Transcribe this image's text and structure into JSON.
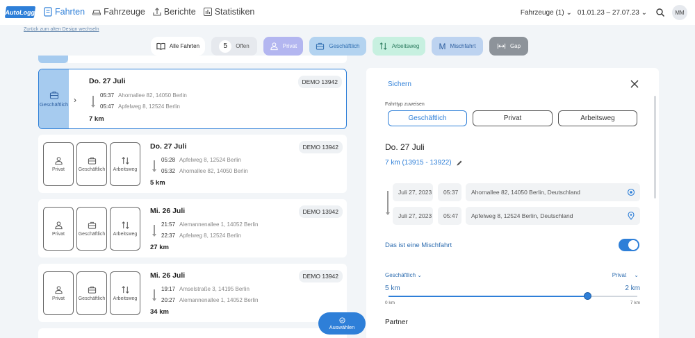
{
  "app": {
    "logo": "AutoLogg"
  },
  "nav": [
    {
      "label": "Fahrten",
      "icon": "document-icon",
      "active": true
    },
    {
      "label": "Fahrzeuge",
      "icon": "car-icon",
      "active": false
    },
    {
      "label": "Berichte",
      "icon": "upload-report-icon",
      "active": false
    },
    {
      "label": "Statistiken",
      "icon": "chart-icon",
      "active": false
    }
  ],
  "topright": {
    "vehicles": "Fahrzeuge (1)",
    "daterange": "01.01.23 – 27.07.23",
    "avatar": "MM"
  },
  "old_design_link": "Zurück zum alten Design wechseln",
  "filters": {
    "all": "Alle Fahrten",
    "open_count": "5",
    "open": "Offen",
    "private": "Privat",
    "business": "Geschäftlich",
    "commute": "Arbeitsweg",
    "mixed": "Mischfahrt",
    "gap": "Gap"
  },
  "categories": {
    "private": "Privat",
    "business": "Geschäftlich",
    "commute": "Arbeitsweg"
  },
  "trips": [
    {
      "date": "Do. 27 Juli",
      "vehicle": "DEMO 13942",
      "start_time": "05:37",
      "start_addr": "Ahornallee 82, 14050 Berlin",
      "end_time": "05:47",
      "end_addr": "Apfelweg 8, 12524 Berlin",
      "distance": "7 km",
      "selected": true
    },
    {
      "date": "Do. 27 Juli",
      "vehicle": "DEMO 13942",
      "start_time": "05:28",
      "start_addr": "Apfelweg 8, 12524 Berlin",
      "end_time": "05:32",
      "end_addr": "Ahornallee 82, 14050 Berlin",
      "distance": "5 km"
    },
    {
      "date": "Mi. 26 Juli",
      "vehicle": "DEMO 13942",
      "start_time": "21:57",
      "start_addr": "Alemannenallee 1, 14052 Berlin",
      "end_time": "22:37",
      "end_addr": "Apfelweg 8, 12524 Berlin",
      "distance": "27 km"
    },
    {
      "date": "Mi. 26 Juli",
      "vehicle": "DEMO 13942",
      "start_time": "19:17",
      "start_addr": "Amselstraße 3, 14195 Berlin",
      "end_time": "20:27",
      "end_addr": "Alemannenallee 1, 14052 Berlin",
      "distance": "34 km"
    }
  ],
  "select_button": "Auswählen",
  "panel": {
    "save": "Sichern",
    "assign_label": "Fahrttyp zuweisen",
    "type_business": "Geschäftlich",
    "type_private": "Privat",
    "type_commute": "Arbeitsweg",
    "date": "Do. 27 Juli",
    "km_range": "7 km (13915 - 13922)",
    "start_date": "Juli 27, 2023",
    "start_time": "05:37",
    "start_addr": "Ahornallee 82, 14050 Berlin, Deutschland",
    "end_date": "Juli 27, 2023",
    "end_time": "05:47",
    "end_addr": "Apfelweg 8, 12524 Berlin, Deutschland",
    "mixed_label": "Das ist eine Mischfahrt",
    "mixed_on": true,
    "left_type": "Geschäftlich",
    "right_type": "Privat",
    "left_km": "5 km",
    "right_km": "2 km",
    "slider_min": "0 km",
    "slider_max": "7 km",
    "slider_fraction": 0.8,
    "partner": "Partner"
  },
  "colors": {
    "accent": "#2e7fd8",
    "business_bg": "#a6cbef",
    "private_chip": "#b3b6f0",
    "commute_chip": "#c7f0e0",
    "gap_chip": "#8d939a"
  }
}
